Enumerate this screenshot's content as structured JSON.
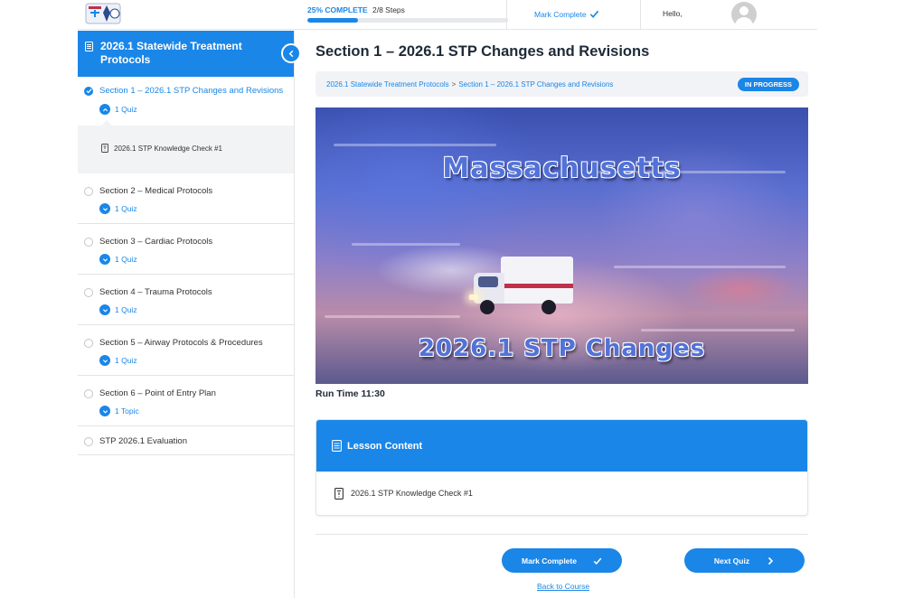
{
  "header": {
    "logo_icon": "course-logo",
    "progress_percent_label": "25% COMPLETE",
    "progress_steps": "2/8 Steps",
    "progress_fraction": 0.25,
    "mark_complete_label": "Mark Complete",
    "greeting": "Hello,"
  },
  "sidebar": {
    "course_title": "2026.1 Statewide Treatment Protocols",
    "sections": [
      {
        "title": "Section 1 – 2026.1 STP Changes and Revisions",
        "sub": "1 Quiz",
        "status": "complete",
        "active": true
      },
      {
        "title": "Section 2 – Medical Protocols",
        "sub": "1 Quiz",
        "status": "incomplete"
      },
      {
        "title": "Section 3 – Cardiac Protocols",
        "sub": "1 Quiz",
        "status": "incomplete"
      },
      {
        "title": "Section 4 – Trauma Protocols",
        "sub": "1 Quiz",
        "status": "incomplete"
      },
      {
        "title": "Section 5 – Airway Protocols & Procedures",
        "sub": "1 Quiz",
        "status": "incomplete"
      },
      {
        "title": "Section 6 – Point of Entry Plan",
        "sub": "1 Topic",
        "status": "incomplete"
      },
      {
        "title": "STP 2026.1 Evaluation",
        "status": "incomplete"
      }
    ],
    "expanded_quiz": "2026.1 STP Knowledge Check #1"
  },
  "main": {
    "lesson_title": "Section 1 – 2026.1 STP Changes and Revisions",
    "breadcrumb": {
      "course": "2026.1 Statewide Treatment Protocols",
      "separator": ">",
      "lesson": "Section 1 – 2026.1 STP Changes and Revisions"
    },
    "status_badge": "IN PROGRESS",
    "video": {
      "title_top": "Massachusetts",
      "title_bottom": "2026.1 STP Changes"
    },
    "run_time": "Run Time 11:30",
    "lesson_content": {
      "heading": "Lesson Content",
      "items": [
        "2026.1 STP Knowledge Check #1"
      ]
    },
    "footer": {
      "mark_complete": "Mark Complete",
      "next": "Next Quiz",
      "back": "Back to Course"
    }
  },
  "colors": {
    "accent": "#1a86e8",
    "heading": "#1e2a39",
    "panel": "#f1f3f6"
  }
}
